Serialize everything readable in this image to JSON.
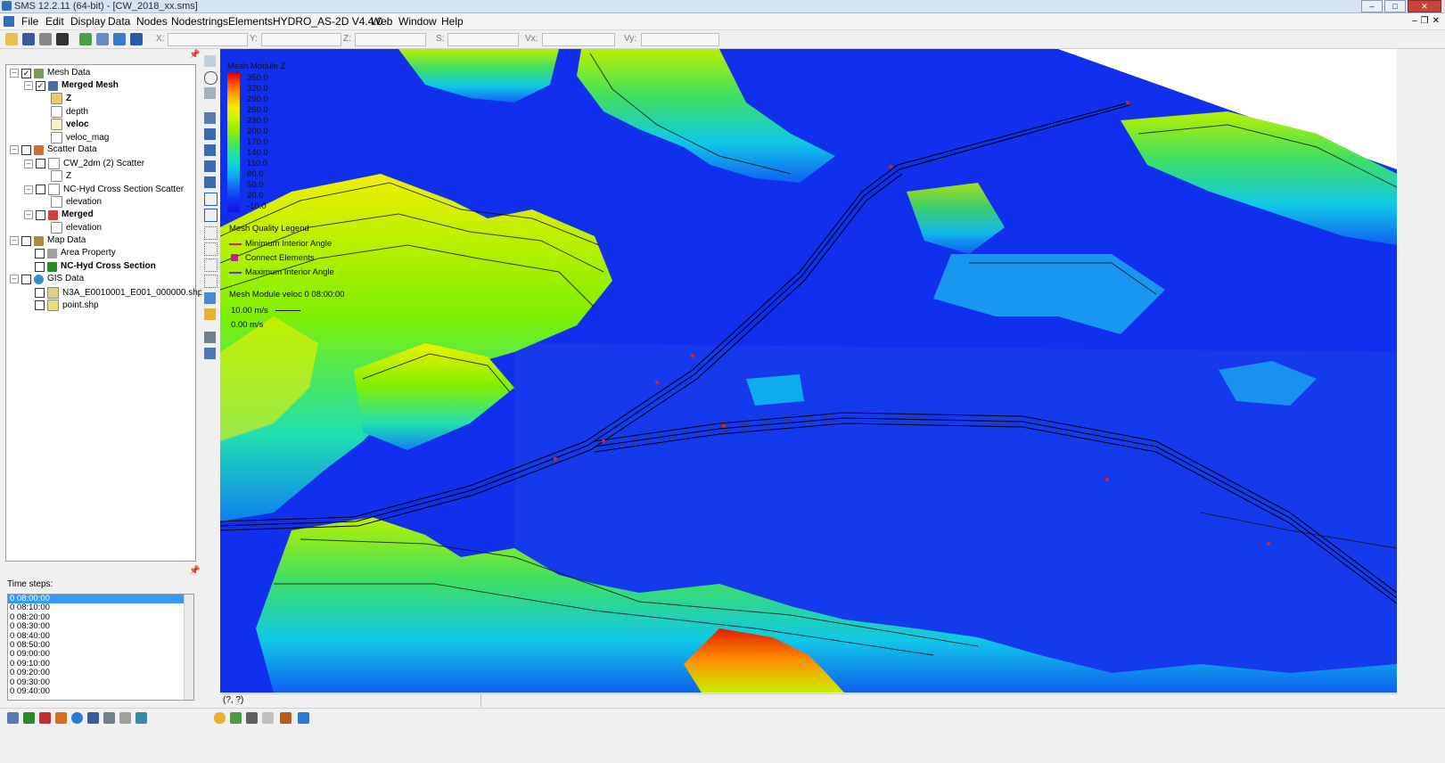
{
  "window": {
    "title": "SMS 12.2.11 (64-bit) - [CW_2018_xx.sms]",
    "controls": [
      "minimize",
      "maximize",
      "close"
    ]
  },
  "menu": {
    "items": [
      "File",
      "Edit",
      "Display",
      "Data",
      "Nodes",
      "Nodestrings",
      "Elements",
      "HYDRO_AS-2D V4.4.0",
      "Web",
      "Window",
      "Help"
    ]
  },
  "toolbar": {
    "coord_labels": [
      "X:",
      "Y:",
      "Z:",
      "S:",
      "Vx:",
      "Vy:"
    ],
    "coord_values": [
      "",
      "",
      "",
      "",
      "",
      ""
    ]
  },
  "tree": {
    "items": [
      {
        "label": "Mesh Data",
        "bold": false,
        "checked": true,
        "icon": "mesh-data-icon"
      },
      {
        "label": "Merged Mesh",
        "bold": true,
        "checked": true,
        "icon": "mesh-icon"
      },
      {
        "label": "Z",
        "bold": true,
        "checked": false,
        "icon": "dataset-icon"
      },
      {
        "label": "depth",
        "bold": false,
        "checked": false,
        "icon": "dataset-icon"
      },
      {
        "label": "veloc",
        "bold": true,
        "checked": false,
        "icon": "vector-dataset-icon"
      },
      {
        "label": "veloc_mag",
        "bold": false,
        "checked": false,
        "icon": "dataset-icon"
      },
      {
        "label": "Scatter Data",
        "bold": false,
        "checked": false,
        "icon": "scatter-data-icon"
      },
      {
        "label": "CW_2dm (2) Scatter",
        "bold": false,
        "checked": false,
        "icon": "scatter-icon"
      },
      {
        "label": "Z",
        "bold": false,
        "checked": false,
        "icon": "dataset-icon"
      },
      {
        "label": "NC-Hyd Cross Section Scatter",
        "bold": false,
        "checked": false,
        "icon": "scatter-icon"
      },
      {
        "label": "elevation",
        "bold": false,
        "checked": false,
        "icon": "dataset-icon"
      },
      {
        "label": "Merged",
        "bold": true,
        "checked": false,
        "icon": "merged-scatter-icon"
      },
      {
        "label": "elevation",
        "bold": false,
        "checked": false,
        "icon": "dataset-icon"
      },
      {
        "label": "Map Data",
        "bold": false,
        "checked": false,
        "icon": "map-data-icon"
      },
      {
        "label": "Area Property",
        "bold": false,
        "checked": false,
        "icon": "coverage-icon"
      },
      {
        "label": "NC-Hyd Cross Section",
        "bold": true,
        "checked": false,
        "icon": "coverage-icon"
      },
      {
        "label": "GIS Data",
        "bold": false,
        "checked": false,
        "icon": "gis-data-icon"
      },
      {
        "label": "N3A_E0010001_E001_000000.shp",
        "bold": false,
        "checked": false,
        "icon": "shapefile-icon"
      },
      {
        "label": "point.shp",
        "bold": false,
        "checked": false,
        "icon": "shapefile-icon"
      }
    ]
  },
  "timesteps": {
    "label": "Time steps:",
    "items": [
      "0 08:00:00",
      "0 08:10:00",
      "0 08:20:00",
      "0 08:30:00",
      "0 08:40:00",
      "0 08:50:00",
      "0 09:00:00",
      "0 09:10:00",
      "0 09:20:00",
      "0 09:30:00",
      "0 09:40:00"
    ],
    "selected": "0 08:00:00"
  },
  "legend": {
    "contour_title": "Mesh Module Z",
    "contour_values": [
      "350.0",
      "320.0",
      "290.0",
      "260.0",
      "230.0",
      "200.0",
      "170.0",
      "140.0",
      "110.0",
      "80.0",
      "50.0",
      "20.0",
      "-10.0"
    ],
    "colors": [
      "#e00000",
      "#ff5a00",
      "#ffb000",
      "#f0f000",
      "#c8f000",
      "#8ff000",
      "#50e850",
      "#20e0a0",
      "#10d0e0",
      "#10a0f0",
      "#1060f0",
      "#1030f0",
      "#1010e8"
    ],
    "quality_title": "Mesh Quality Legend",
    "quality_items": [
      "Minimum Interior Angle",
      "Connect Elements",
      "Maximum Interior Angle"
    ],
    "vector_title": "Mesh Module veloc 0 08:00:00",
    "vector_max": "10.00 m/s",
    "vector_min": "0.00 m/s"
  },
  "status": {
    "text": "(?, ?)"
  }
}
